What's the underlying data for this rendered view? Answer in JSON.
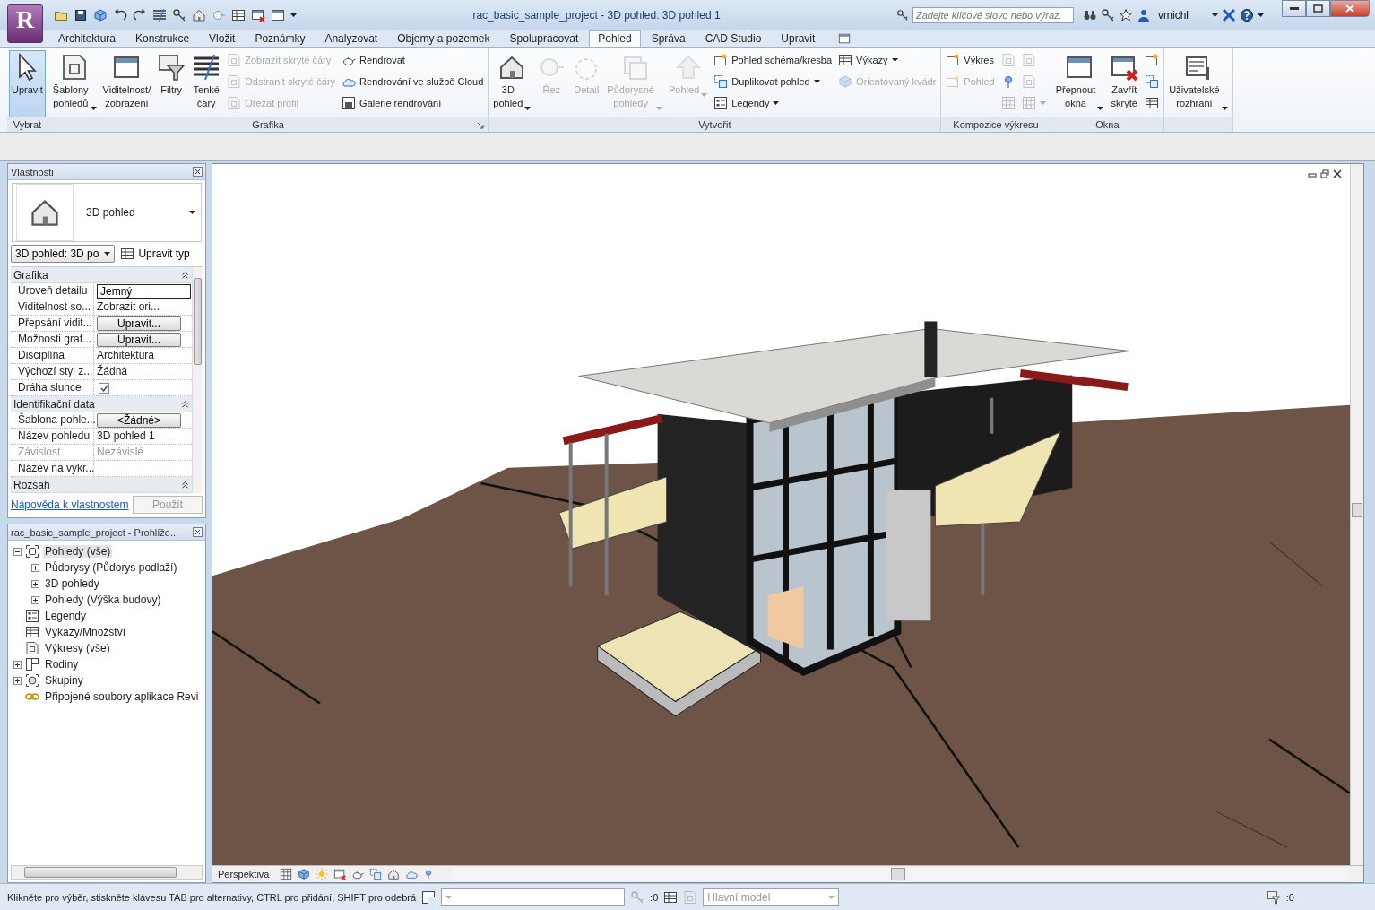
{
  "title_bar": {
    "app_button": "R",
    "title": "rac_basic_sample_project - 3D pohled: 3D pohled 1",
    "search": {
      "placeholder": "Zadejte klíčové slovo nebo výraz."
    },
    "user": "vmichl"
  },
  "menu_tabs": [
    {
      "label": "Architektura",
      "selected": false
    },
    {
      "label": "Konstrukce",
      "selected": false
    },
    {
      "label": "Vložit",
      "selected": false
    },
    {
      "label": "Poznámky",
      "selected": false
    },
    {
      "label": "Analyzovat",
      "selected": false
    },
    {
      "label": "Objemy a pozemek",
      "selected": false
    },
    {
      "label": "Spolupracovat",
      "selected": false
    },
    {
      "label": "Pohled",
      "selected": true
    },
    {
      "label": "Správa",
      "selected": false
    },
    {
      "label": "CAD Studio",
      "selected": false
    },
    {
      "label": "Upravit",
      "selected": false
    }
  ],
  "ribbon_panels": [
    {
      "title": "Vybrat",
      "groups": [
        {
          "kind": "large",
          "label": "Upravit",
          "selected": true,
          "disabled": false,
          "dropdown": false
        }
      ]
    },
    {
      "title": "Grafika",
      "dialog_launcher": true,
      "groups": [
        {
          "kind": "large",
          "label": "Šablony\npohledů",
          "selected": false,
          "disabled": false,
          "dropdown": true
        },
        {
          "kind": "large",
          "label": "Viditelnost/\nzobrazení",
          "selected": false,
          "disabled": false,
          "dropdown": false
        },
        {
          "kind": "large",
          "label": "Filtry",
          "selected": false,
          "disabled": false,
          "dropdown": false
        },
        {
          "kind": "large",
          "label": "Tenké\nčáry",
          "selected": false,
          "disabled": false,
          "dropdown": false
        },
        {
          "kind": "stack",
          "items": [
            {
              "label": "Zobrazit skryté čáry",
              "disabled": true,
              "dropdown": false
            },
            {
              "label": "Odstranit skryté čáry",
              "disabled": true,
              "dropdown": false
            },
            {
              "label": "Ořezat profil",
              "disabled": true,
              "dropdown": false
            }
          ]
        },
        {
          "kind": "stack",
          "items": [
            {
              "label": "Rendrovat",
              "disabled": false,
              "dropdown": false
            },
            {
              "label": "Rendrování ve službě Cloud",
              "disabled": false,
              "dropdown": false
            },
            {
              "label": "Galerie rendrování",
              "disabled": false,
              "dropdown": false
            }
          ]
        }
      ]
    },
    {
      "title": "Vytvořit",
      "groups": [
        {
          "kind": "large",
          "label": "3D\npohled",
          "selected": false,
          "disabled": false,
          "dropdown": true
        },
        {
          "kind": "large",
          "label": "Řez",
          "selected": false,
          "disabled": true,
          "dropdown": false
        },
        {
          "kind": "large",
          "label": "Detail",
          "selected": false,
          "disabled": true,
          "dropdown": false
        },
        {
          "kind": "large",
          "label": "Půdorysné\npohledy",
          "selected": false,
          "disabled": true,
          "dropdown": true
        },
        {
          "kind": "large",
          "label": "Pohled",
          "selected": false,
          "disabled": true,
          "dropdown": true
        },
        {
          "kind": "stack",
          "items": [
            {
              "label": "Pohled schéma/kresba",
              "disabled": false,
              "dropdown": false
            },
            {
              "label": "Duplikovat pohled",
              "disabled": false,
              "dropdown": true
            },
            {
              "label": "Legendy",
              "disabled": false,
              "dropdown": true
            }
          ]
        },
        {
          "kind": "stack",
          "items": [
            {
              "label": "Výkazy",
              "disabled": false,
              "dropdown": true
            },
            {
              "label": "Orientovaný kvádr",
              "disabled": true,
              "dropdown": false
            }
          ]
        }
      ]
    },
    {
      "title": "Kompozice výkresu",
      "groups": [
        {
          "kind": "stack",
          "items": [
            {
              "label": "Výkres",
              "disabled": false,
              "dropdown": false
            },
            {
              "label": "Pohled",
              "disabled": true,
              "dropdown": false
            }
          ]
        },
        {
          "kind": "stack",
          "items": [
            {
              "disabled": true,
              "dropdown": false
            },
            {
              "disabled": false,
              "dropdown": false
            },
            {
              "disabled": true,
              "dropdown": false
            }
          ]
        },
        {
          "kind": "stack",
          "items": [
            {
              "disabled": true,
              "dropdown": false
            },
            {
              "disabled": true,
              "dropdown": false
            },
            {
              "disabled": true,
              "dropdown": true
            }
          ]
        }
      ]
    },
    {
      "title": "Okna",
      "groups": [
        {
          "kind": "large",
          "label": "Přepnout\nokna",
          "selected": false,
          "disabled": false,
          "dropdown": true
        },
        {
          "kind": "large",
          "label": "Zavřít\nskryté",
          "selected": false,
          "disabled": false,
          "dropdown": false
        },
        {
          "kind": "stack",
          "items": [
            {
              "disabled": false,
              "dropdown": false
            },
            {
              "disabled": false,
              "dropdown": false
            },
            {
              "disabled": false,
              "dropdown": false
            }
          ]
        }
      ]
    },
    {
      "groups": [
        {
          "kind": "large",
          "label": "Uživatelské\nrozhraní",
          "selected": false,
          "disabled": false,
          "dropdown": true
        }
      ]
    }
  ],
  "properties": {
    "title": "Vlastnosti",
    "type_selector": "3D pohled",
    "instance_selector": "3D pohled: 3D po",
    "edit_type_button": "Upravit typ",
    "sections": [
      {
        "title": "Grafika",
        "rows": [
          {
            "name": "Úroveň detailu",
            "value": "Jemný",
            "kind": "field",
            "disabled": false
          },
          {
            "name": "Viditelnost so...",
            "value": "Zobrazit ori...",
            "kind": "text",
            "disabled": false
          },
          {
            "name": "Přepsání vidit...",
            "value": "Upravit...",
            "kind": "button",
            "disabled": false
          },
          {
            "name": "Možnosti graf...",
            "value": "Upravit...",
            "kind": "button",
            "disabled": false
          },
          {
            "name": "Disciplína",
            "value": "Architektura",
            "kind": "text",
            "disabled": false
          },
          {
            "name": "Výchozí styl z...",
            "value": "Žádná",
            "kind": "text",
            "disabled": false
          },
          {
            "name": "Dráha slunce",
            "kind": "checkbox",
            "checked": true,
            "disabled": false
          }
        ]
      },
      {
        "title": "Identifikační data",
        "rows": [
          {
            "name": "Šablona pohle...",
            "value": "<Žádné>",
            "kind": "button",
            "disabled": false
          },
          {
            "name": "Název pohledu",
            "value": "3D pohled 1",
            "kind": "text",
            "disabled": false
          },
          {
            "name": "Závislost",
            "value": "Nezávislé",
            "kind": "text",
            "disabled": true
          },
          {
            "name": "Název na výkr...",
            "kind": "text",
            "disabled": false
          }
        ]
      },
      {
        "title": "Rozsah"
      }
    ],
    "help_link": "Nápověda k vlastnostem",
    "apply_button": {
      "label": "Použít",
      "disabled": true
    }
  },
  "browser": {
    "title": "rac_basic_sample_project - Prohlíže...",
    "tree": [
      {
        "label": "Pohledy (vše)",
        "kind": "views",
        "expanded": true,
        "selected": true,
        "children": [
          {
            "label": "Půdorysy (Půdorys podlaží)",
            "expanded": false,
            "selected": false
          },
          {
            "label": "3D pohledy",
            "expanded": false,
            "selected": false
          },
          {
            "label": "Pohledy (Výška budovy)",
            "expanded": false,
            "selected": false
          }
        ]
      },
      {
        "label": "Legendy",
        "kind": "legend",
        "selected": false
      },
      {
        "label": "Výkazy/Množství",
        "kind": "schedule",
        "selected": false
      },
      {
        "label": "Výkresy (vše)",
        "kind": "sheet",
        "selected": false
      },
      {
        "label": "Rodiny",
        "kind": "family",
        "expanded": false,
        "selected": false
      },
      {
        "label": "Skupiny",
        "kind": "group",
        "expanded": false,
        "selected": false
      },
      {
        "label": "Připojené soubory aplikace Revi",
        "kind": "link",
        "selected": false
      }
    ]
  },
  "view": {
    "view_bar_label": "Perspektiva"
  },
  "status_bar": {
    "message": "Klikněte pro výběr, stiskněte klávesu TAB pro alternativy, CTRL pro přidání, SHIFT pro odebrá",
    "editing_count": ":0",
    "model": {
      "value": "Hlavní model",
      "disabled": true
    },
    "filter_count": ":0"
  }
}
